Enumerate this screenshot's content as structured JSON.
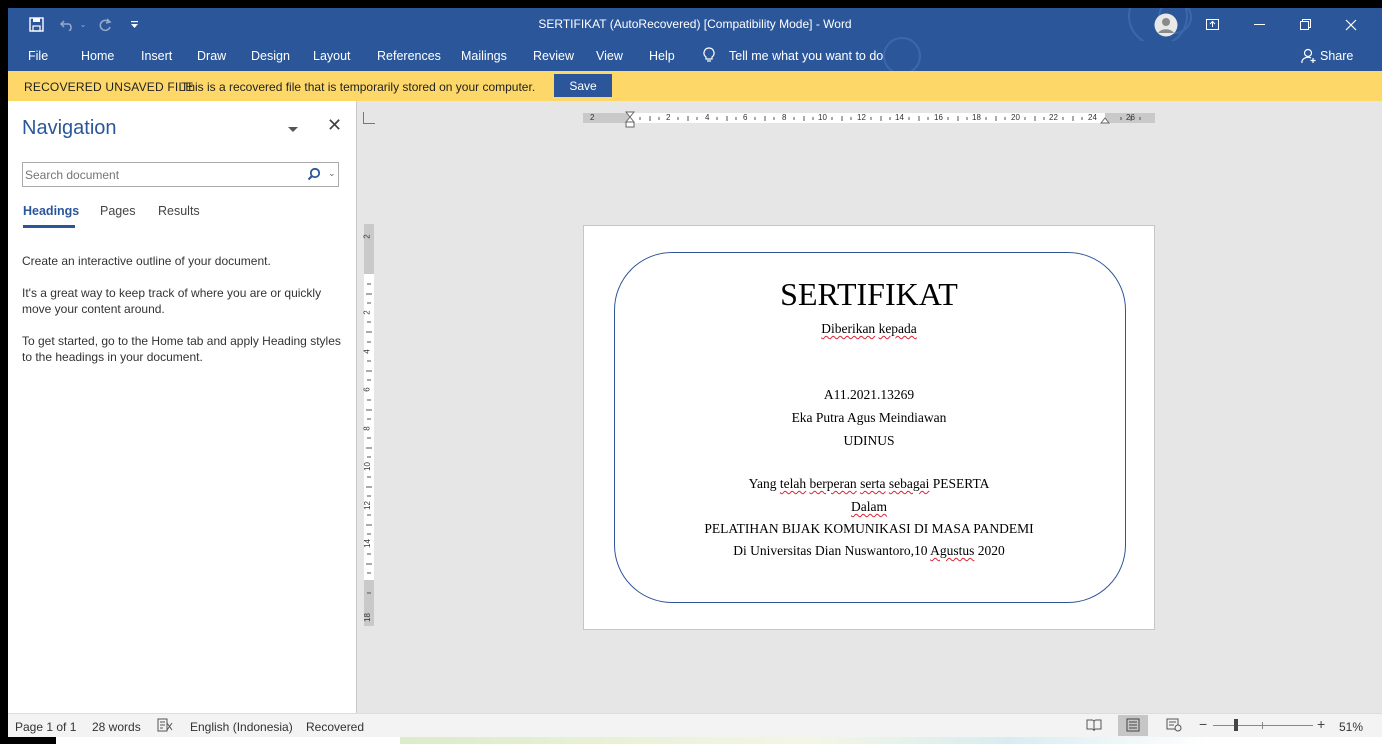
{
  "window": {
    "title": "SERTIFIKAT (AutoRecovered) [Compatibility Mode]  -  Word",
    "share_label": "Share"
  },
  "ribbon": {
    "tabs": [
      "File",
      "Home",
      "Insert",
      "Draw",
      "Design",
      "Layout",
      "References",
      "Mailings",
      "Review",
      "View",
      "Help"
    ],
    "tell_me": "Tell me what you want to do"
  },
  "message_bar": {
    "heading": "RECOVERED UNSAVED FILE",
    "text": "This is a recovered file that is temporarily stored on your computer.",
    "button": "Save"
  },
  "navigation": {
    "title": "Navigation",
    "search_placeholder": "Search document",
    "tabs": [
      "Headings",
      "Pages",
      "Results"
    ],
    "para1": "Create an interactive outline of your document.",
    "para2": "It's a great way to keep track of where you are or quickly move your content around.",
    "para3": "To get started, go to the Home tab and apply Heading styles to the headings in your document."
  },
  "ruler": {
    "h_labels": [
      "2",
      "2",
      "4",
      "6",
      "8",
      "10",
      "12",
      "14",
      "16",
      "18",
      "20",
      "22",
      "24",
      "26"
    ],
    "v_labels": [
      "2",
      "2",
      "4",
      "6",
      "8",
      "10",
      "12",
      "14",
      "18"
    ]
  },
  "document": {
    "title": "SERTIFIKAT",
    "given_to_1": "Diberikan",
    "given_to_2": "kepada",
    "nim": "A11.2021.13269",
    "name": "Eka Putra Agus Meindiawan",
    "institution": "UDINUS",
    "role_1": "Yang",
    "role_2": "telah",
    "role_3": "berperan",
    "role_4": "serta",
    "role_5": "sebagai",
    "role_6": "PESERTA",
    "in_word": "Dalam",
    "event": "PELATIHAN BIJAK KOMUNIKASI DI MASA PANDEMI",
    "place": "Di Universitas Dian Nuswantoro,10",
    "month": "Agustus",
    "year": "2020"
  },
  "status": {
    "page": "Page 1 of 1",
    "words": "28 words",
    "language": "English (Indonesia)",
    "recovered": "Recovered",
    "zoom": "51%"
  },
  "colors": {
    "accent": "#2b579a",
    "message_bar": "#fdd868",
    "frame": "#2f5597"
  }
}
